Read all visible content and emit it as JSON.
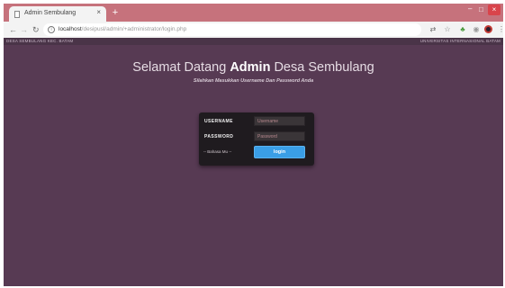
{
  "browser": {
    "tab_title": "Admin Sembulang",
    "tab_close": "×",
    "new_tab": "+",
    "url_host": "localhost",
    "url_path": "/desipusl/admin/+administrator/login.php",
    "window_controls": {
      "minimize": "–",
      "maximize": "□",
      "close": "×"
    }
  },
  "site_strip": {
    "left_text": "DESA SEMBULANG KEC. BATAM",
    "right_text": "UNIVERSITAS INTERNASIONAL BATAM"
  },
  "header": {
    "welcome_prefix": "Selamat Datang ",
    "welcome_bold": "Admin",
    "welcome_suffix": " Desa Sembulang",
    "subtitle": "Silahkan Masukkan Username Dan Password Anda"
  },
  "login": {
    "username_label": "USERNAME",
    "username_placeholder": "Username",
    "username_value": "",
    "password_label": "PASSWORD",
    "password_placeholder": "Password",
    "password_value": "",
    "language_option": "-- Bahasa Mu --",
    "submit_label": "login"
  },
  "colors": {
    "page_bg": "#573a53",
    "tabstrip_bg": "#c6727c",
    "card_bg": "#1f1b1f",
    "button_bg": "#3a9ee6"
  }
}
